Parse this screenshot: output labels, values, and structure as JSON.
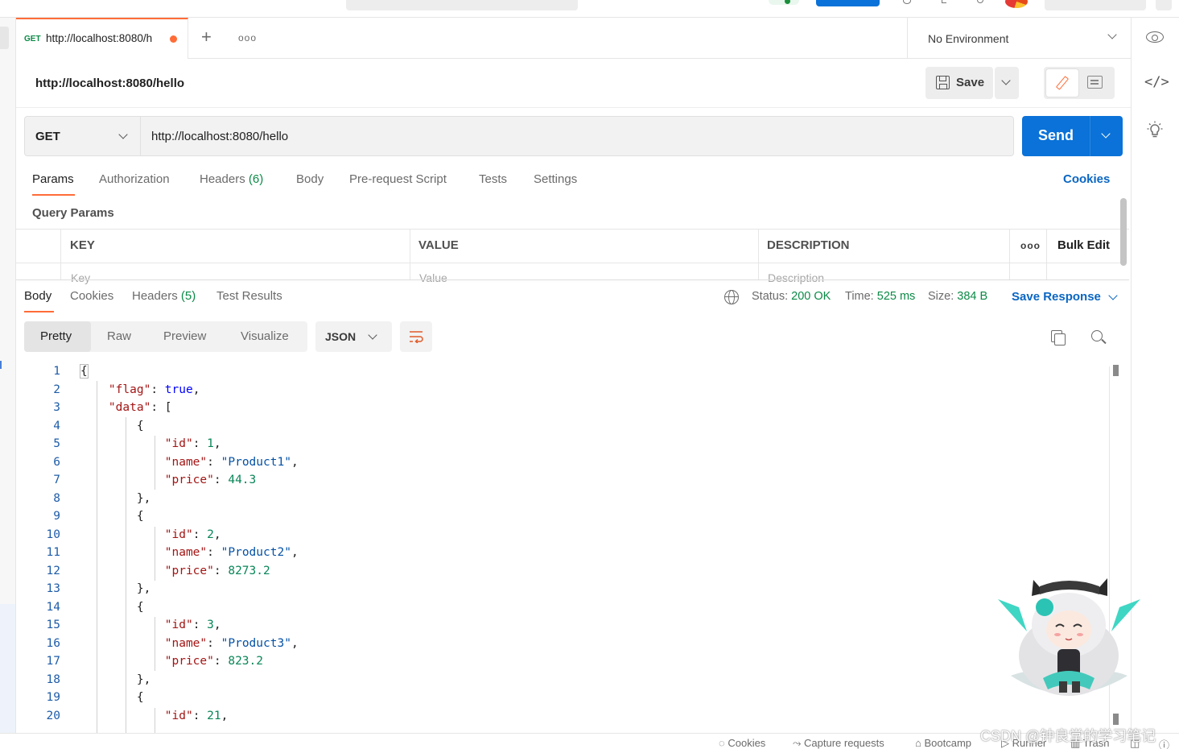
{
  "tab": {
    "method": "GET",
    "url": "http://localhost:8080/h"
  },
  "environment": {
    "selected": "No Environment"
  },
  "request": {
    "name": "http://localhost:8080/hello",
    "save_label": "Save",
    "method": "GET",
    "url": "http://localhost:8080/hello",
    "send_label": "Send"
  },
  "request_tabs": {
    "params": "Params",
    "authorization": "Authorization",
    "headers": "Headers",
    "headers_count": "(6)",
    "body": "Body",
    "prerequest": "Pre-request Script",
    "tests": "Tests",
    "settings": "Settings",
    "cookies": "Cookies"
  },
  "query_params": {
    "title": "Query Params",
    "columns": [
      "KEY",
      "VALUE",
      "DESCRIPTION"
    ],
    "placeholders": [
      "Key",
      "Value",
      "Description"
    ],
    "bulk_edit": "Bulk Edit"
  },
  "response": {
    "tabs": {
      "body": "Body",
      "cookies": "Cookies",
      "headers": "Headers",
      "headers_count": "(5)",
      "test_results": "Test Results"
    },
    "status_label": "Status:",
    "status_value": "200 OK",
    "time_label": "Time:",
    "time_value": "525 ms",
    "size_label": "Size:",
    "size_value": "384 B",
    "save_response": "Save Response",
    "views": [
      "Pretty",
      "Raw",
      "Preview",
      "Visualize"
    ],
    "format": "JSON",
    "line_numbers": [
      "1",
      "2",
      "3",
      "4",
      "5",
      "6",
      "7",
      "8",
      "9",
      "10",
      "11",
      "12",
      "13",
      "14",
      "15",
      "16",
      "17",
      "18",
      "19",
      "20"
    ],
    "keys": {
      "flag": "\"flag\"",
      "data": "\"data\"",
      "id": "\"id\"",
      "name": "\"name\"",
      "price": "\"price\""
    },
    "values": {
      "flag": "true",
      "items": [
        {
          "id": "1",
          "name": "\"Product1\"",
          "price": "44.3"
        },
        {
          "id": "2",
          "name": "\"Product2\"",
          "price": "8273.2"
        },
        {
          "id": "3",
          "name": "\"Product3\"",
          "price": "823.2"
        },
        {
          "id": "21"
        }
      ]
    }
  },
  "status_bar": {
    "cookies": "Cookies",
    "capture": "Capture requests",
    "bootcamp": "Bootcamp",
    "runner": "Runner",
    "trash": "Trash"
  },
  "watermark": "CSDN @钟良堂的学习笔记",
  "icons": {
    "eye": "eye-icon",
    "code": "code-icon",
    "bulb": "lightbulb-icon",
    "globe": "globe-icon",
    "copy": "copy-icon",
    "search": "search-icon",
    "wrap": "wrap-lines-icon",
    "save": "save-icon",
    "pencil": "pencil-icon",
    "comment": "comment-icon"
  },
  "colors": {
    "accent": "#ff6c37",
    "primary_blue": "#0a72d8",
    "link_blue": "#0a66c2",
    "success_green": "#0b8a47"
  }
}
